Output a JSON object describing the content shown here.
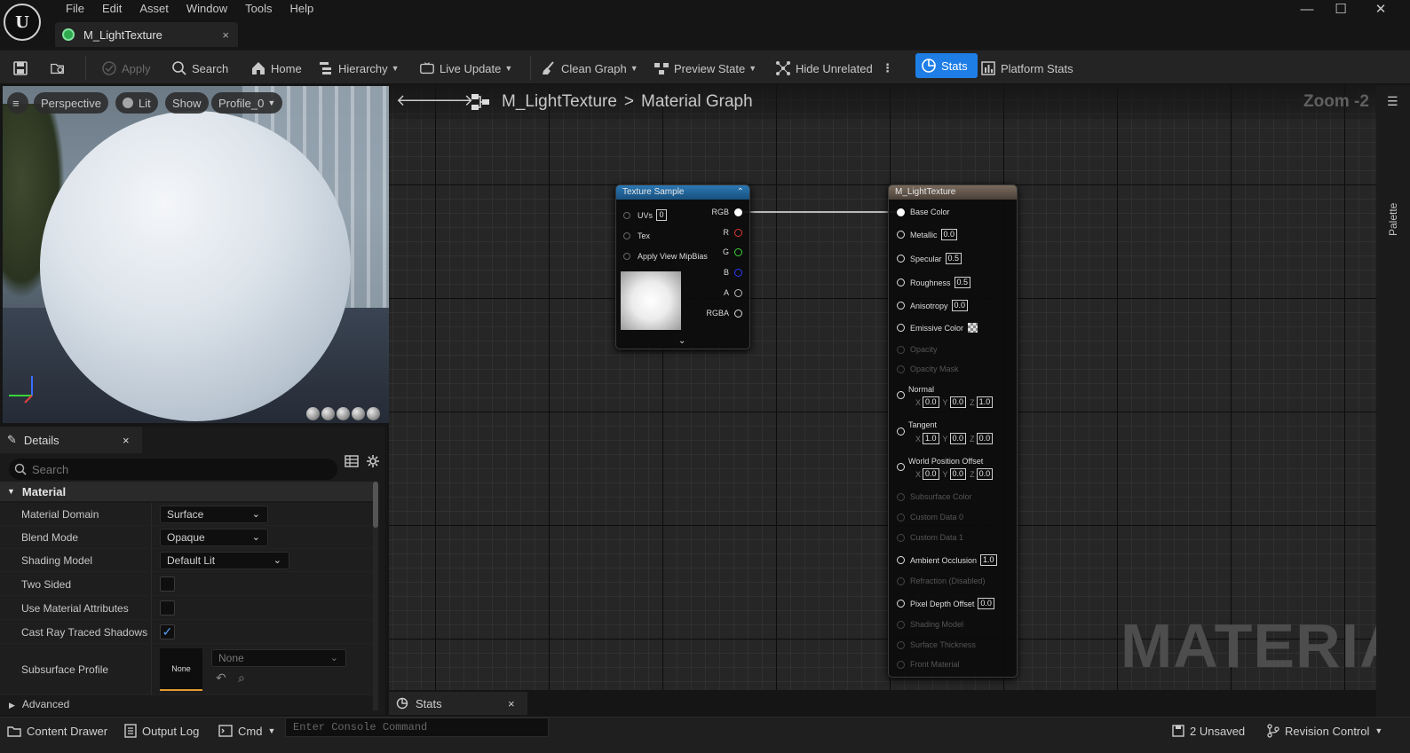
{
  "app": {
    "logo": "U"
  },
  "menu": [
    "File",
    "Edit",
    "Asset",
    "Window",
    "Tools",
    "Help"
  ],
  "document_tab": {
    "label": "M_LightTexture",
    "close": "×"
  },
  "window_controls": {
    "minimize": "—",
    "maximize": "☐",
    "close": "✕"
  },
  "toolbar": {
    "apply": "Apply",
    "search": "Search",
    "home": "Home",
    "hierarchy": "Hierarchy",
    "live_update": "Live Update",
    "clean_graph": "Clean Graph",
    "preview_state": "Preview State",
    "hide_unrelated": "Hide Unrelated",
    "stats": "Stats",
    "platform_stats": "Platform Stats"
  },
  "viewport": {
    "perspective": "Perspective",
    "lit": "Lit",
    "show": "Show",
    "profile": "Profile_0"
  },
  "details": {
    "tab_label": "Details",
    "search_placeholder": "Search",
    "category": "Material",
    "rows": {
      "material_domain": {
        "label": "Material Domain",
        "value": "Surface"
      },
      "blend_mode": {
        "label": "Blend Mode",
        "value": "Opaque"
      },
      "shading_model": {
        "label": "Shading Model",
        "value": "Default Lit"
      },
      "two_sided": {
        "label": "Two Sided",
        "checked": false
      },
      "use_material_attributes": {
        "label": "Use Material Attributes",
        "checked": false
      },
      "cast_ray_traced_shadows": {
        "label": "Cast Ray Traced Shadows",
        "checked": true
      },
      "subsurface_profile": {
        "label": "Subsurface Profile",
        "thumb": "None",
        "value": "None"
      }
    },
    "advanced": "Advanced"
  },
  "graph": {
    "breadcrumb": {
      "asset": "M_LightTexture",
      "separator": ">",
      "graph": "Material Graph"
    },
    "zoom": "Zoom -2",
    "watermark": "MATERIAL",
    "palette": "Palette",
    "texture_node": {
      "title": "Texture Sample",
      "inputs": {
        "uvs": "UVs",
        "uvs_value": "0",
        "tex": "Tex",
        "mipbias": "Apply View MipBias"
      },
      "outputs": {
        "rgb": "RGB",
        "r": "R",
        "g": "G",
        "b": "B",
        "a": "A",
        "rgba": "RGBA"
      }
    },
    "material_node": {
      "title": "M_LightTexture",
      "pins": {
        "base_color": "Base Color",
        "metallic": "Metallic",
        "metallic_value": "0.0",
        "specular": "Specular",
        "specular_value": "0.5",
        "roughness": "Roughness",
        "roughness_value": "0.5",
        "anisotropy": "Anisotropy",
        "anisotropy_value": "0.0",
        "emissive": "Emissive Color",
        "opacity": "Opacity",
        "opacity_mask": "Opacity Mask",
        "normal": "Normal",
        "normal_x": "0.0",
        "normal_y": "0.0",
        "normal_z": "1.0",
        "tangent": "Tangent",
        "tangent_x": "1.0",
        "tangent_y": "0.0",
        "tangent_z": "0.0",
        "wpo": "World Position Offset",
        "wpo_x": "0.0",
        "wpo_y": "0.0",
        "wpo_z": "0.0",
        "subsurface": "Subsurface Color",
        "custom0": "Custom Data 0",
        "custom1": "Custom Data 1",
        "ao": "Ambient Occlusion",
        "ao_value": "1.0",
        "refraction": "Refraction (Disabled)",
        "pdo": "Pixel Depth Offset",
        "pdo_value": "0.0",
        "shading_model": "Shading Model",
        "surface_thickness": "Surface Thickness",
        "front_material": "Front Material",
        "axis_x": "X",
        "axis_y": "Y",
        "axis_z": "Z"
      }
    }
  },
  "stats_panel": {
    "label": "Stats",
    "close": "×"
  },
  "statusbar": {
    "content_drawer": "Content Drawer",
    "output_log": "Output Log",
    "cmd": "Cmd",
    "console_placeholder": "Enter Console Command",
    "unsaved": "2 Unsaved",
    "revision_control": "Revision Control"
  },
  "colors": {
    "accent": "#1e7ee6",
    "texture_header": "#1c5a8a",
    "material_header": "#5c5149"
  }
}
